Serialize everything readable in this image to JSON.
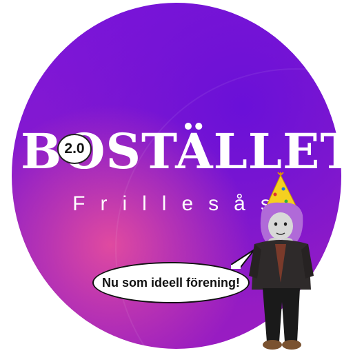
{
  "logo": {
    "title": "BOSTÄLLET",
    "version_badge": "2.0",
    "subtitle": "Frillesås"
  },
  "speech_bubble": {
    "text": "Nu som ideell förening!"
  },
  "colors": {
    "disc_purple": "#7a14dc",
    "disc_magenta": "#e04aa0",
    "text_white": "#ffffff",
    "party_hat_yellow": "#f5d020",
    "hair_purple": "#b06ad8"
  }
}
